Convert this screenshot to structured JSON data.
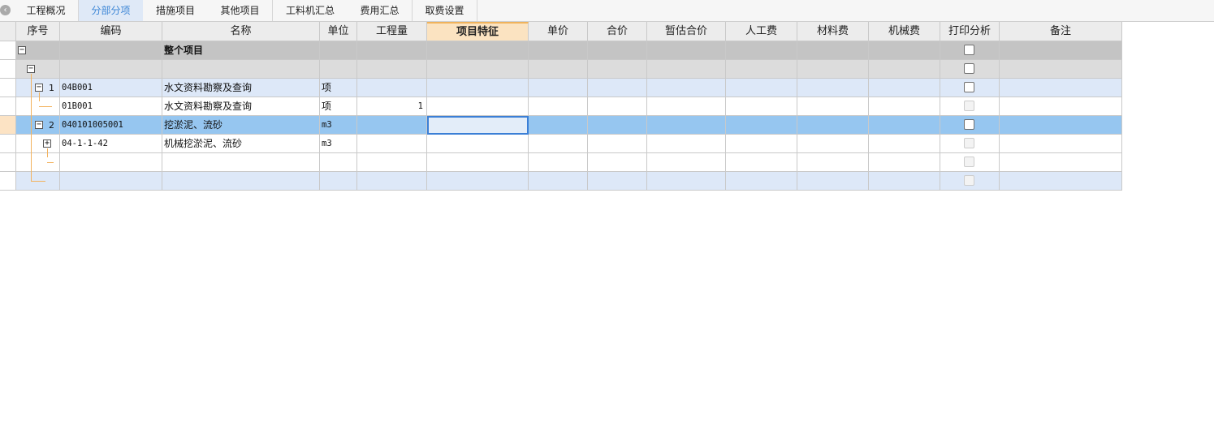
{
  "tabs": [
    {
      "label": "工程概况",
      "active": false
    },
    {
      "label": "分部分项",
      "active": true
    },
    {
      "label": "措施项目",
      "active": false
    },
    {
      "label": "其他项目",
      "active": false
    },
    {
      "label": "工料机汇总",
      "active": false
    },
    {
      "label": "费用汇总",
      "active": false
    },
    {
      "label": "取费设置",
      "active": false
    }
  ],
  "columns": [
    "序号",
    "编码",
    "名称",
    "单位",
    "工程量",
    "项目特征",
    "单价",
    "合价",
    "暂估合价",
    "人工费",
    "材料费",
    "机械费",
    "打印分析",
    "备注"
  ],
  "selected_column": "项目特征",
  "rows": [
    {
      "seq": "",
      "code": "",
      "name": "整个项目",
      "unit": "",
      "qty": "",
      "style": "group",
      "print_disabled": false
    },
    {
      "seq": "",
      "code": "",
      "name": "",
      "unit": "",
      "qty": "",
      "style": "subgroup",
      "print_disabled": false
    },
    {
      "seq": "1",
      "code": "04B001",
      "name": "水文资料勘察及查询",
      "unit": "项",
      "qty": "",
      "style": "item",
      "print_disabled": false
    },
    {
      "seq": "",
      "code": "01B001",
      "name": "水文资料勘察及查询",
      "unit": "项",
      "qty": "1",
      "style": "detail",
      "print_disabled": true
    },
    {
      "seq": "2",
      "code": "040101005001",
      "name": "挖淤泥、流砂",
      "unit": "m3",
      "qty": "",
      "style": "selected",
      "print_disabled": false
    },
    {
      "seq": "",
      "code": "04-1-1-42",
      "name": "机械挖淤泥、流砂",
      "unit": "m3",
      "qty": "",
      "style": "detail",
      "print_disabled": true
    },
    {
      "seq": "",
      "code": "",
      "name": "",
      "unit": "",
      "qty": "",
      "style": "empty",
      "print_disabled": true
    },
    {
      "seq": "",
      "code": "",
      "name": "",
      "unit": "",
      "qty": "",
      "style": "item",
      "print_disabled": true
    }
  ],
  "colors": {
    "group_bg": "#c4c4c4",
    "subgroup_bg": "#dcdcdc",
    "item_bg": "#dde8f8",
    "detail_bg": "#ffffff",
    "selected_bg": "#96c6f0",
    "active_tab_text": "#3d86d6",
    "tree_line": "#f3b35e"
  },
  "icons": {
    "back": "back-circle-icon",
    "collapse": "minus-box-icon",
    "expand": "plus-box-icon"
  }
}
